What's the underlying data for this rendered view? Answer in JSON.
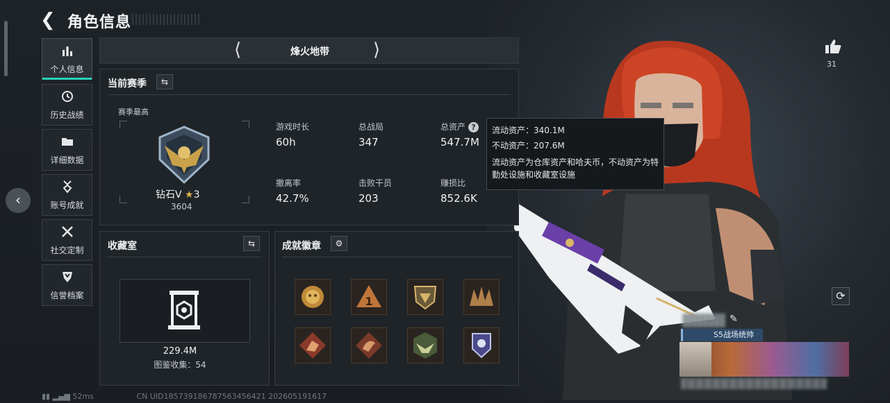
{
  "header": {
    "title": "角色信息"
  },
  "sidebar": {
    "items": [
      {
        "label": "个人信息",
        "icon": "bar-chart-icon",
        "active": true
      },
      {
        "label": "历史战绩",
        "icon": "clock-icon",
        "active": false
      },
      {
        "label": "详细数据",
        "icon": "folder-icon",
        "active": false
      },
      {
        "label": "账号成就",
        "icon": "medal-icon",
        "active": false
      },
      {
        "label": "社交定制",
        "icon": "tools-icon",
        "active": false
      },
      {
        "label": "信誉档案",
        "icon": "shield-icon",
        "active": false
      }
    ]
  },
  "map_selector": {
    "current": "烽火地带"
  },
  "season": {
    "title": "当前赛季",
    "best_label": "赛季最高",
    "rank_name": "钻石V",
    "rank_stars": "3",
    "rank_points": "3604",
    "stats": [
      {
        "label": "游戏时长",
        "value": "60h"
      },
      {
        "label": "总战局",
        "value": "347"
      },
      {
        "label": "总资产",
        "value": "547.7M"
      },
      {
        "label": "撤离率",
        "value": "42.7%"
      },
      {
        "label": "击败干员",
        "value": "203"
      },
      {
        "label": "赚损比",
        "value": "852.6K"
      }
    ]
  },
  "tooltip": {
    "line1": "流动资产：340.1M",
    "line2": "不动资产：207.6M",
    "desc": "流动资产为仓库资产和哈夫币，不动资产为特勤处设施和收藏室设施"
  },
  "collection": {
    "title": "收藏室",
    "value": "229.4M",
    "count_text": "图鉴收集：54"
  },
  "achievements": {
    "title": "成就徽章",
    "badges": [
      "gold-tiger-badge",
      "rank-one-badge",
      "crest-badge",
      "spikes-badge",
      "climber-badge",
      "dragon-badge",
      "eagle-badge",
      "police-badge"
    ]
  },
  "profile": {
    "like_count": "31",
    "title_badge": "S5战场统帅"
  },
  "footer": {
    "ping": "52ms",
    "uid": "CN UID185739186787563456421 202605191617"
  },
  "colors": {
    "accent": "#27d3b4",
    "panel": "#1f2428",
    "border": "#353c42"
  }
}
